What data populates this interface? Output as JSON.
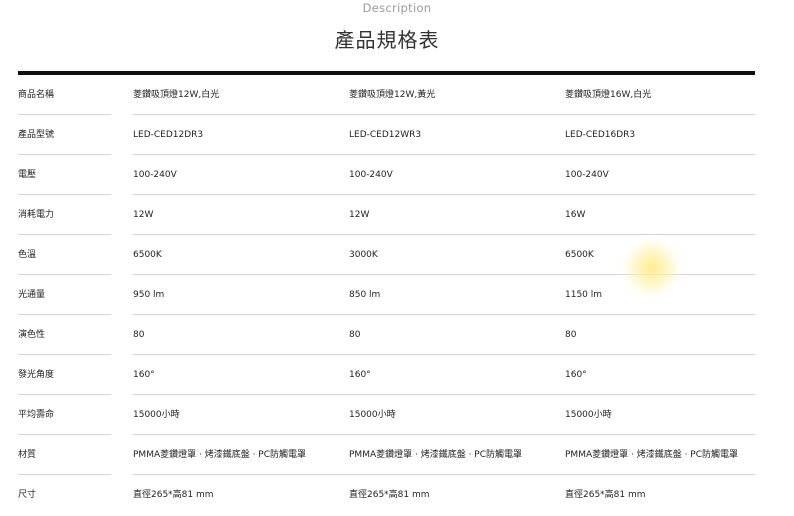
{
  "header": {
    "subtitle": "Description",
    "title": "產品規格表"
  },
  "spec_table": {
    "rows": [
      {
        "label": "商品名稱",
        "values": [
          "菱鑽吸頂燈12W,白光",
          "菱鑽吸頂燈12W,黃光",
          "菱鑽吸頂燈16W,白光"
        ]
      },
      {
        "label": "產品型號",
        "values": [
          "LED-CED12DR3",
          "LED-CED12WR3",
          "LED-CED16DR3"
        ]
      },
      {
        "label": "電壓",
        "values": [
          "100-240V",
          "100-240V",
          "100-240V"
        ]
      },
      {
        "label": "消耗電力",
        "values": [
          "12W",
          "12W",
          "16W"
        ]
      },
      {
        "label": "色溫",
        "values": [
          "6500K",
          "3000K",
          "6500K"
        ]
      },
      {
        "label": "光通量",
        "values": [
          "950 lm",
          "850 lm",
          "1150 lm"
        ]
      },
      {
        "label": "演色性",
        "values": [
          "80",
          "80",
          "80"
        ]
      },
      {
        "label": "發光角度",
        "values": [
          "160°",
          "160°",
          "160°"
        ]
      },
      {
        "label": "平均壽命",
        "values": [
          "15000小時",
          "15000小時",
          "15000小時"
        ]
      },
      {
        "label": "材質",
        "values": [
          "PMMA菱鑽燈罩 · 烤漆鐵底盤 · PC防觸電罩",
          "PMMA菱鑽燈罩 · 烤漆鐵底盤 · PC防觸電罩",
          "PMMA菱鑽燈罩 · 烤漆鐵底盤 · PC防觸電罩"
        ]
      },
      {
        "label": "尺寸",
        "values": [
          "直徑265*高81 mm",
          "直徑265*高81 mm",
          "直徑265*高81 mm"
        ]
      }
    ]
  }
}
